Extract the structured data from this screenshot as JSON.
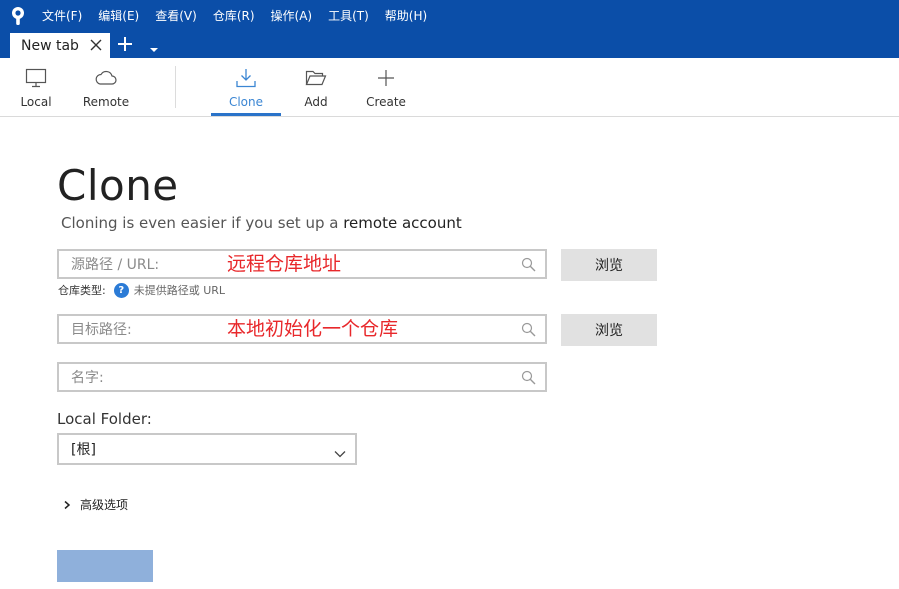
{
  "menubar": {
    "items": [
      "文件(F)",
      "编辑(E)",
      "查看(V)",
      "仓库(R)",
      "操作(A)",
      "工具(T)",
      "帮助(H)"
    ]
  },
  "tabs": {
    "active_label": "New tab"
  },
  "toolbar": {
    "local": "Local",
    "remote": "Remote",
    "clone": "Clone",
    "add": "Add",
    "create": "Create"
  },
  "main": {
    "title": "Clone",
    "subtitle_prefix": "Cloning is even easier if you set up a ",
    "subtitle_link": "remote account",
    "source": {
      "placeholder": "源路径 / URL:",
      "annotation": "远程仓库地址",
      "browse": "浏览"
    },
    "repo_type": {
      "label": "仓库类型:",
      "help": "?",
      "value": "未提供路径或 URL"
    },
    "target": {
      "placeholder": "目标路径:",
      "annotation": "本地初始化一个仓库",
      "browse": "浏览"
    },
    "name": {
      "placeholder": "名字:"
    },
    "local_folder": {
      "label": "Local Folder:",
      "value": "[根]"
    },
    "advanced": "高级选项"
  },
  "colors": {
    "titlebar": "#0b4ea8",
    "accent": "#2a73c9",
    "annotation": "#e8282b",
    "disabled_button": "#8fb0db"
  }
}
